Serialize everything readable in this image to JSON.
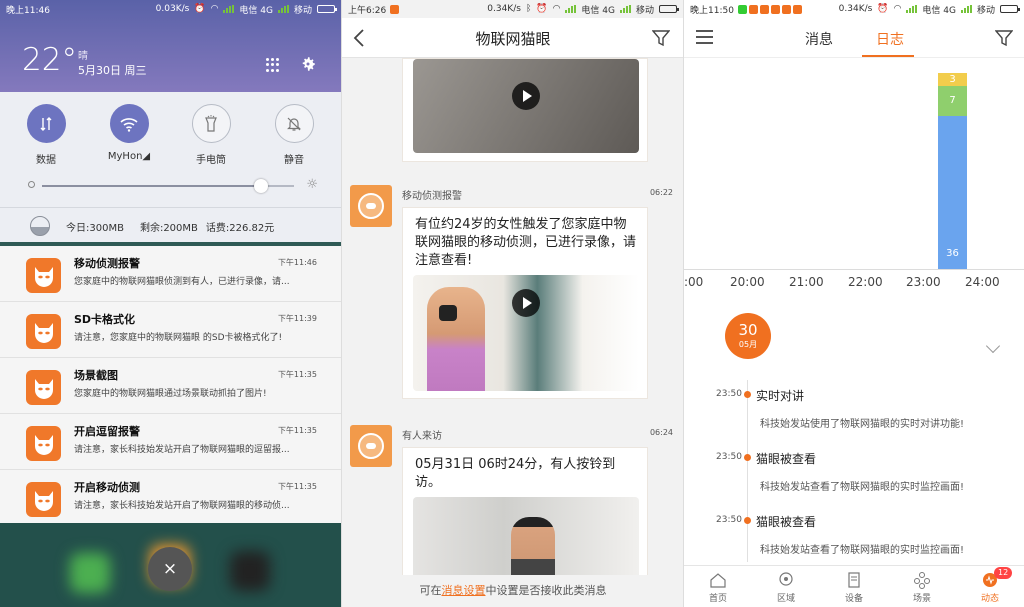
{
  "p1": {
    "status": {
      "time": "晚上11:46",
      "speed": "0.03K/s",
      "carrier": "电信 4G",
      "carrier2": "移动"
    },
    "weather": {
      "temp": "22°",
      "cond": "晴",
      "date": "5月30日 周三"
    },
    "quick": [
      {
        "label": "数据"
      },
      {
        "label": "MyHon◢"
      },
      {
        "label": "手电筒"
      },
      {
        "label": "静音"
      }
    ],
    "brightness": 0.87,
    "data_usage": {
      "today": "今日:300MB",
      "left": "剩余:200MB",
      "fee": "话费:226.82元"
    },
    "notifications": [
      {
        "title": "移动侦测报警",
        "time": "下午11:46",
        "text": "您家庭中的物联网猫眼侦测到有人，已进行录像，请..."
      },
      {
        "title": "SD卡格式化",
        "time": "下午11:39",
        "text": "请注意，您家庭中的物联网猫眼 的SD卡被格式化了!"
      },
      {
        "title": "场景截图",
        "time": "下午11:35",
        "text": "您家庭中的物联网猫眼通过场景联动抓拍了图片!"
      },
      {
        "title": "开启逗留报警",
        "time": "下午11:35",
        "text": "请注意，家长科技始发站开启了物联网猫眼的逗留报..."
      },
      {
        "title": "开启移动侦测",
        "time": "下午11:35",
        "text": "请注意，家长科技始发站开启了物联网猫眼的移动侦..."
      }
    ],
    "close_label": "×"
  },
  "p2": {
    "status": {
      "time": "上午6:26",
      "speed": "0.34K/s",
      "carrier": "电信 4G",
      "carrier2": "移动"
    },
    "title": "物联网猫眼",
    "messages": [
      {
        "title": "移动侦测报警",
        "time": "06:22",
        "text": "有位约24岁的女性触发了您家庭中物联网猫眼的移动侦测，已进行录像，请注意查看!"
      },
      {
        "title": "有人来访",
        "time": "06:24",
        "text": "05月31日 06时24分，有人按铃到访。"
      }
    ],
    "footer": {
      "pre": "可在",
      "link": "消息设置",
      "post": "中设置是否接收此类消息"
    }
  },
  "p3": {
    "status": {
      "time": "晚上11:50",
      "speed": "0.34K/s",
      "carrier": "电信 4G",
      "carrier2": "移动"
    },
    "tabs": [
      {
        "label": "消息",
        "active": false
      },
      {
        "label": "日志",
        "active": true
      }
    ],
    "chart_data": {
      "type": "bar",
      "x_ticks": [
        ":00",
        "20:00",
        "21:00",
        "22:00",
        "23:00",
        "24:00"
      ],
      "stack_at": "23:00–24:00",
      "series": [
        {
          "value": 36,
          "color": "#6aa4ee"
        },
        {
          "value": 7,
          "color": "#8fcf6d"
        },
        {
          "value": 3,
          "color": "#f2cd4c"
        }
      ]
    },
    "date": {
      "day": "30",
      "month": "05月"
    },
    "events": [
      {
        "time": "23:50",
        "title": "实时对讲",
        "text": "科技始发站使用了物联网猫眼的实时对讲功能!"
      },
      {
        "time": "23:50",
        "title": "猫眼被查看",
        "text": "科技始发站查看了物联网猫眼的实时监控画面!"
      },
      {
        "time": "23:50",
        "title": "猫眼被查看",
        "text": "科技始发站查看了物联网猫眼的实时监控画面!"
      }
    ],
    "tabbar": [
      {
        "label": "首页",
        "icon": "home-icon"
      },
      {
        "label": "区域",
        "icon": "location-icon"
      },
      {
        "label": "设备",
        "icon": "device-icon"
      },
      {
        "label": "场景",
        "icon": "scene-icon"
      },
      {
        "label": "动态",
        "icon": "activity-icon",
        "badge": "12",
        "active": true
      }
    ]
  }
}
